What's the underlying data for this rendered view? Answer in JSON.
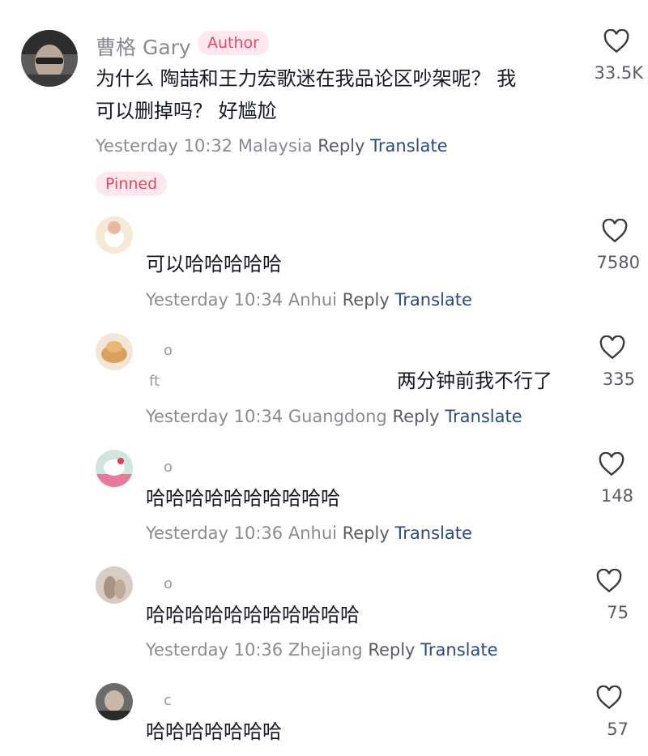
{
  "author_comment": {
    "name": "曹格 Gary",
    "badge": "Author",
    "text_line1": "为什么 陶喆和王力宏歌迷在我品论区吵架呢？ 我",
    "text_line2": "可以删掉吗？  好尴尬",
    "time": "Yesterday 10:32",
    "location": "Malaysia",
    "reply": "Reply",
    "translate": "Translate",
    "likes": "33.5K",
    "pinned": "Pinned"
  },
  "replies": [
    {
      "name": "",
      "text": "可以哈哈哈哈哈",
      "time": "Yesterday 10:34",
      "location": "Anhui",
      "reply": "Reply",
      "translate": "Translate",
      "likes": "7580"
    },
    {
      "name": "o",
      "text_prefix": "ft",
      "text": "两分钟前我不行了",
      "time": "Yesterday 10:34",
      "location": "Guangdong",
      "reply": "Reply",
      "translate": "Translate",
      "likes": "335"
    },
    {
      "name": "o",
      "text": "哈哈哈哈哈哈哈哈哈哈",
      "time": "Yesterday 10:36",
      "location": "Anhui",
      "reply": "Reply",
      "translate": "Translate",
      "likes": "148"
    },
    {
      "name": "o",
      "text": "哈哈哈哈哈哈哈哈哈哈哈",
      "time": "Yesterday 10:36",
      "location": "Zhejiang",
      "reply": "Reply",
      "translate": "Translate",
      "likes": "75"
    },
    {
      "name": "c",
      "text": "哈哈哈哈哈哈哈",
      "time": "",
      "location": "",
      "reply": "",
      "translate": "",
      "likes": "57"
    }
  ],
  "colors": {
    "badge_bg": "#fde8ee",
    "badge_text": "#e5485f",
    "translate": "#2b4a7e",
    "meta": "#8a8b91"
  }
}
